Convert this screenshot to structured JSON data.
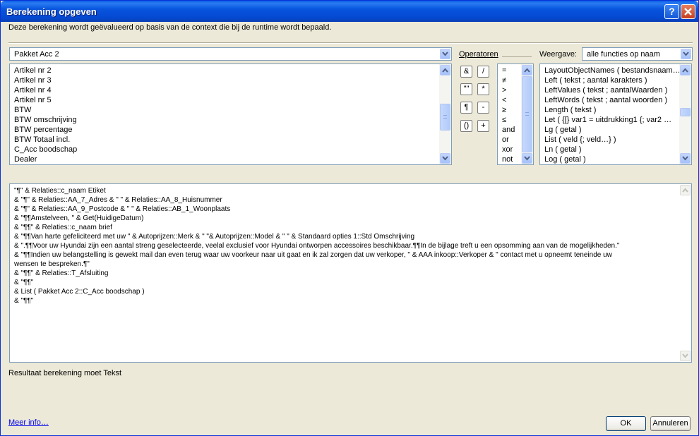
{
  "window": {
    "title": "Berekening opgeven"
  },
  "description": "Deze berekening wordt geëvalueerd op basis van de context die bij de runtime wordt bepaald.",
  "table_select": {
    "value": "Pakket Acc 2"
  },
  "fields": [
    "Artikel nr 2",
    "Artikel nr 3",
    "Artikel nr 4",
    "Artikel nr 5",
    "BTW",
    "BTW omschrijving",
    "BTW percentage",
    "BTW Totaal incl.",
    "C_Acc boodschap",
    "Dealer"
  ],
  "operators_label": "Operatoren",
  "operator_buttons": [
    "&",
    "/",
    "\"\"",
    "*",
    "¶",
    "-",
    "()",
    "+"
  ],
  "comparison_operators": [
    "=",
    "≠",
    ">",
    "<",
    "≥",
    "≤",
    "and",
    "or",
    "xor",
    "not"
  ],
  "view_label": "Weergave:",
  "view_select": {
    "value": "alle functies op naam"
  },
  "functions": [
    "LayoutObjectNames ( bestandsnaam…",
    "Left ( tekst ; aantal karakters )",
    "LeftValues ( tekst ; aantalWaarden )",
    "LeftWords ( tekst ; aantal woorden )",
    "Length ( tekst )",
    "Let ( {[} var1 = uitdrukking1 {; var2 …",
    "Lg ( getal )",
    "List ( veld {; veld…} )",
    "Ln ( getal )",
    "Log ( getal )"
  ],
  "formula_lines": [
    " \"¶\" & Relaties::c_naam Etiket",
    "& \"¶\" & Relaties::AA_7_Adres & \" \" & Relaties::AA_8_Huisnummer",
    "& \"¶\" & Relaties::AA_9_Postcode & \"  \" & Relaties::AB_1_Woonplaats",
    "& \"¶¶Amstelveen, \" & Get(HuidigeDatum)",
    "& \"¶¶\" & Relaties::c_naam brief",
    "& \"¶¶Van harte gefeliciteerd met uw \"  & Autoprijzen::Merk  & \" \"& Autoprijzen::Model & \" \" & Standaard opties 1::Std Omschrijving",
    "& \".¶¶Voor uw Hyundai zijn een aantal streng geselecteerde, veelal exclusief voor Hyundai ontworpen accessoires beschikbaar.¶¶In de bijlage treft u een opsomming aan van de mogelijkheden.\"",
    "& \"¶¶Indien uw belangstelling is gewekt mail dan even terug waar uw voorkeur naar uit gaat en ik zal zorgen dat uw verkoper, \" & AAA inkoop::Verkoper & \" contact met u opneemt teneinde uw",
    "wensen te bespreken.¶\"",
    "& \"¶¶\" & Relaties::T_Afsluiting",
    "& \"¶¶\"",
    "& List ( Pakket Acc 2::C_Acc boodschap )",
    "& \"¶¶\""
  ],
  "result_label": "Resultaat berekening moet",
  "result_type": "Tekst",
  "more_info": "Meer info…",
  "ok_label": "OK",
  "cancel_label": "Annuleren",
  "colors": {
    "titlebar": "#0855dd",
    "dialog": "#ece9d8",
    "link": "#0000ee"
  }
}
